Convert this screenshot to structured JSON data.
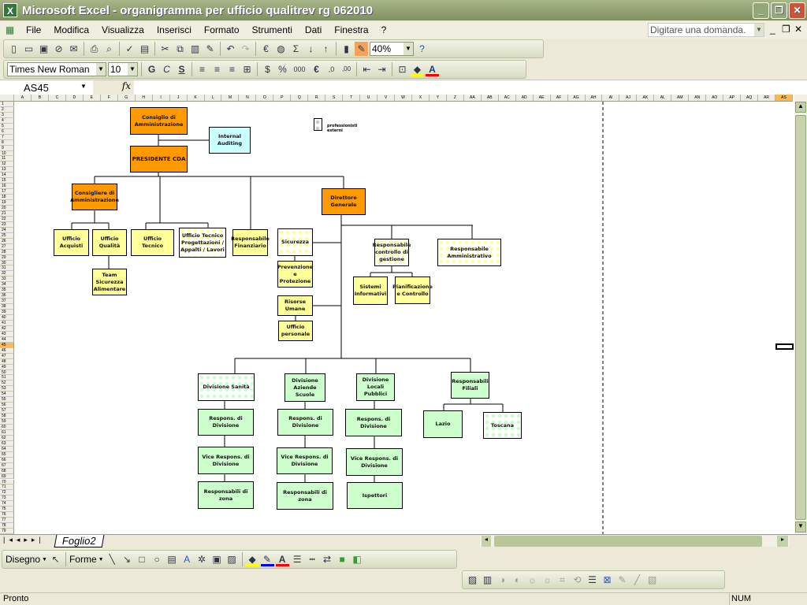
{
  "window": {
    "title": "Microsoft Excel - organigramma per ufficio qualitrev rg 062010",
    "app_icon": "excel-icon"
  },
  "menu": {
    "items": [
      "File",
      "Modifica",
      "Visualizza",
      "Inserisci",
      "Formato",
      "Strumenti",
      "Dati",
      "Finestra",
      "?"
    ],
    "help_placeholder": "Digitare una domanda."
  },
  "toolbar": {
    "zoom": "40%",
    "font": "Times New Roman",
    "font_size": "10",
    "bold": "G",
    "italic": "C",
    "underline": "S",
    "percent": "%",
    "thousands": "000",
    "euro": "€",
    "fill_color": "#ffff00",
    "font_color": "#ff0000"
  },
  "formula": {
    "name_box": "AS45",
    "fx": "fx",
    "content": ""
  },
  "sheet": {
    "columns": [
      "A",
      "B",
      "C",
      "D",
      "E",
      "F",
      "G",
      "H",
      "I",
      "J",
      "K",
      "L",
      "M",
      "N",
      "O",
      "P",
      "Q",
      "R",
      "S",
      "T",
      "U",
      "V",
      "W",
      "X",
      "Y",
      "Z",
      "AA",
      "AB",
      "AC",
      "AD",
      "AE",
      "AF",
      "AG",
      "AH",
      "AI",
      "AJ",
      "AK",
      "AL",
      "AM",
      "AN",
      "AO",
      "AP",
      "AQ",
      "AR",
      "AS"
    ],
    "first_row": 1,
    "last_row": 79,
    "selected_column": "AS",
    "selected_row": 45,
    "tab": "Foglio2"
  },
  "chart": {
    "legend": "professionisti esterni",
    "cda": "Consiglio di Amministrazione",
    "audit": "Internal Auditing",
    "presidente": "PRESIDENTE CDA",
    "consigliere": "Consigliere di Amministrazione",
    "dg": "Direttore Generale",
    "acquisti": "Ufficio Acquisti",
    "qualita": "Ufficio Qualità",
    "team": "Team Sicurezza Alimentare",
    "tecnico": "Ufficio Tecnico",
    "tecnico_prog": "Ufficio Tecnico Progettazioni / Appalti / Lavori",
    "finanziario": "Responsabile Finanziario",
    "sicurezza": "Sicurezza",
    "prevenzione": "Prevenzione e Protezione",
    "risorse": "Risorse Umane",
    "personale": "Ufficio personale",
    "controllo": "Responsabile controllo di gestione",
    "amministrativo": "Responsabile Amministrativo",
    "sistemi": "Sistemi Informativi",
    "pianificazione": "Pianificazione e Controllo",
    "div_sanita": "Divisione Sanità",
    "div_scuole": "Divisione Aziende Scuole",
    "div_locali": "Divisione Locali Pubblici",
    "filiali": "Responsabili Filiali",
    "lazio": "Lazio",
    "toscana": "Toscana",
    "resp_div": "Respons. di Divisione",
    "vice": "Vice Respons. di Divisione",
    "zona": "Responsabili di zona",
    "ispettori": "Ispettori",
    "colors": {
      "top": "#ff9900",
      "audit": "#ccffff",
      "staff": "#ffff99",
      "division": "#ccffcc"
    }
  },
  "drawing": {
    "disegno": "Disegno",
    "forme": "Forme"
  },
  "status": {
    "text": "Pronto",
    "num": "NUM"
  }
}
